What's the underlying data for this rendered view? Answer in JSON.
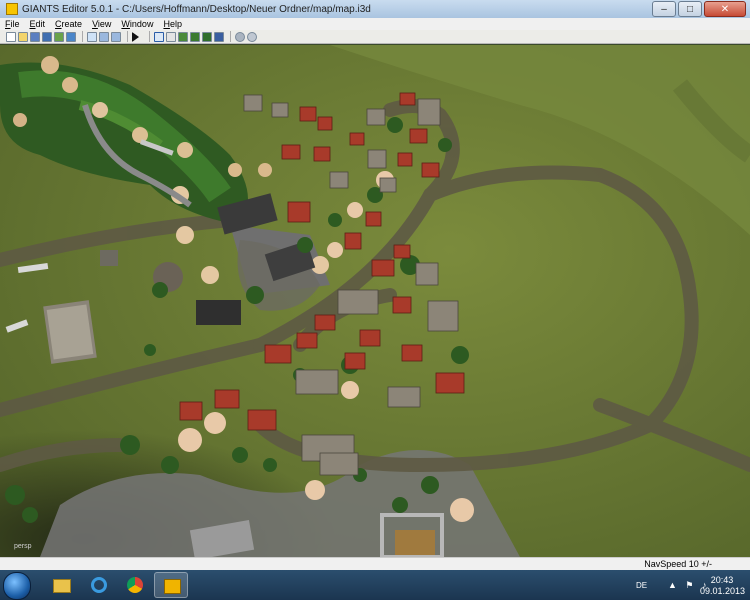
{
  "window": {
    "title": "GIANTS Editor 5.0.1 - C:/Users/Hoffmann/Desktop/Neuer Ordner/map/map.i3d",
    "minimize_label": "–",
    "maximize_label": "□",
    "close_label": "✕"
  },
  "menu": {
    "items": [
      {
        "label": "File",
        "mnemonic": "F",
        "rest": "ile"
      },
      {
        "label": "Edit",
        "mnemonic": "E",
        "rest": "dit"
      },
      {
        "label": "Create",
        "mnemonic": "C",
        "rest": "reate"
      },
      {
        "label": "View",
        "mnemonic": "V",
        "rest": "iew"
      },
      {
        "label": "Window",
        "mnemonic": "W",
        "rest": "indow"
      },
      {
        "label": "Help",
        "mnemonic": "H",
        "rest": "elp"
      }
    ]
  },
  "toolbar": {
    "buttons": [
      "new-file-icon",
      "open-file-icon",
      "save-icon",
      "save-as-icon",
      "import-icon",
      "export-icon",
      "refresh-icon",
      "undo-icon",
      "redo-icon",
      "play-icon",
      "select-tool-icon",
      "move-tool-icon",
      "terrain-sculpt-icon",
      "terrain-paint-icon",
      "foliage-paint-icon",
      "vertex-paint-icon",
      "settings-icon",
      "find-icon"
    ]
  },
  "viewport": {
    "camera_label": "persp"
  },
  "statusbar": {
    "nav_speed": "NavSpeed 10 +/-"
  },
  "taskbar": {
    "apps": [
      "windows-explorer-icon",
      "internet-explorer-icon",
      "chrome-icon",
      "giants-editor-icon"
    ],
    "language": "DE",
    "time": "20:43",
    "date": "09.01.2013"
  },
  "colors": {
    "grass": "#6b7d35",
    "dirt_road": "#5e5a44",
    "gravel": "#6e6e6e",
    "forest": "#2f5a22",
    "roof_red": "#a83a2a",
    "roof_grey": "#8c8578",
    "blossom": "#e8c9a8"
  }
}
